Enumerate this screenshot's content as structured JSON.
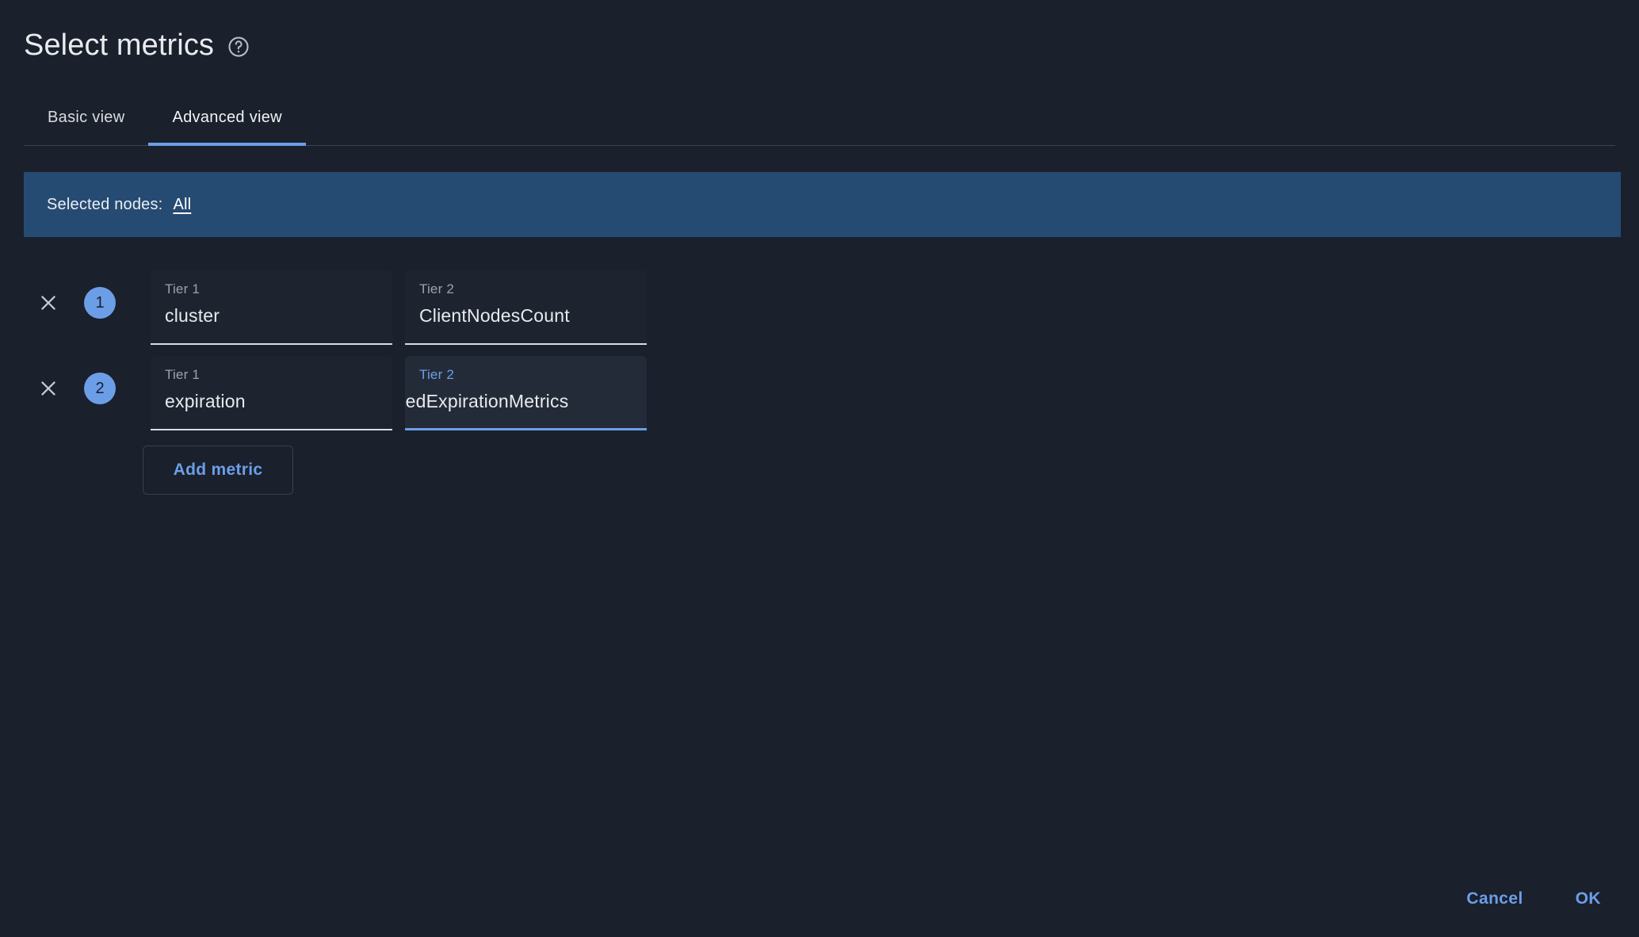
{
  "header": {
    "title": "Select metrics",
    "help_icon": "help-circle-icon"
  },
  "tabs": [
    {
      "label": "Basic view",
      "active": false
    },
    {
      "label": "Advanced view",
      "active": true
    }
  ],
  "nodes_banner": {
    "label": "Selected nodes:",
    "value": "All",
    "background": "#264b73"
  },
  "metrics": [
    {
      "index": "1",
      "remove_icon": "close-icon",
      "tier1": {
        "label": "Tier 1",
        "value": "cluster",
        "focused": false
      },
      "tier2": {
        "label": "Tier 2",
        "value": "ClientNodesCount",
        "focused": false
      }
    },
    {
      "index": "2",
      "remove_icon": "close-icon",
      "tier1": {
        "label": "Tier 1",
        "value": "expiration",
        "focused": false
      },
      "tier2": {
        "label": "Tier 2",
        "value": "iledExpirationMetrics",
        "focused": true
      }
    }
  ],
  "add_metric": {
    "label": "Add metric"
  },
  "footer": {
    "cancel_label": "Cancel",
    "ok_label": "OK"
  },
  "colors": {
    "page_background": "#1a202c",
    "accent": "#6c9ee8",
    "banner": "#264b73",
    "field_background": "#1d2430",
    "field_background_focused": "#242b38",
    "text_primary": "#e8eaed",
    "text_secondary": "#9aa2ae"
  }
}
